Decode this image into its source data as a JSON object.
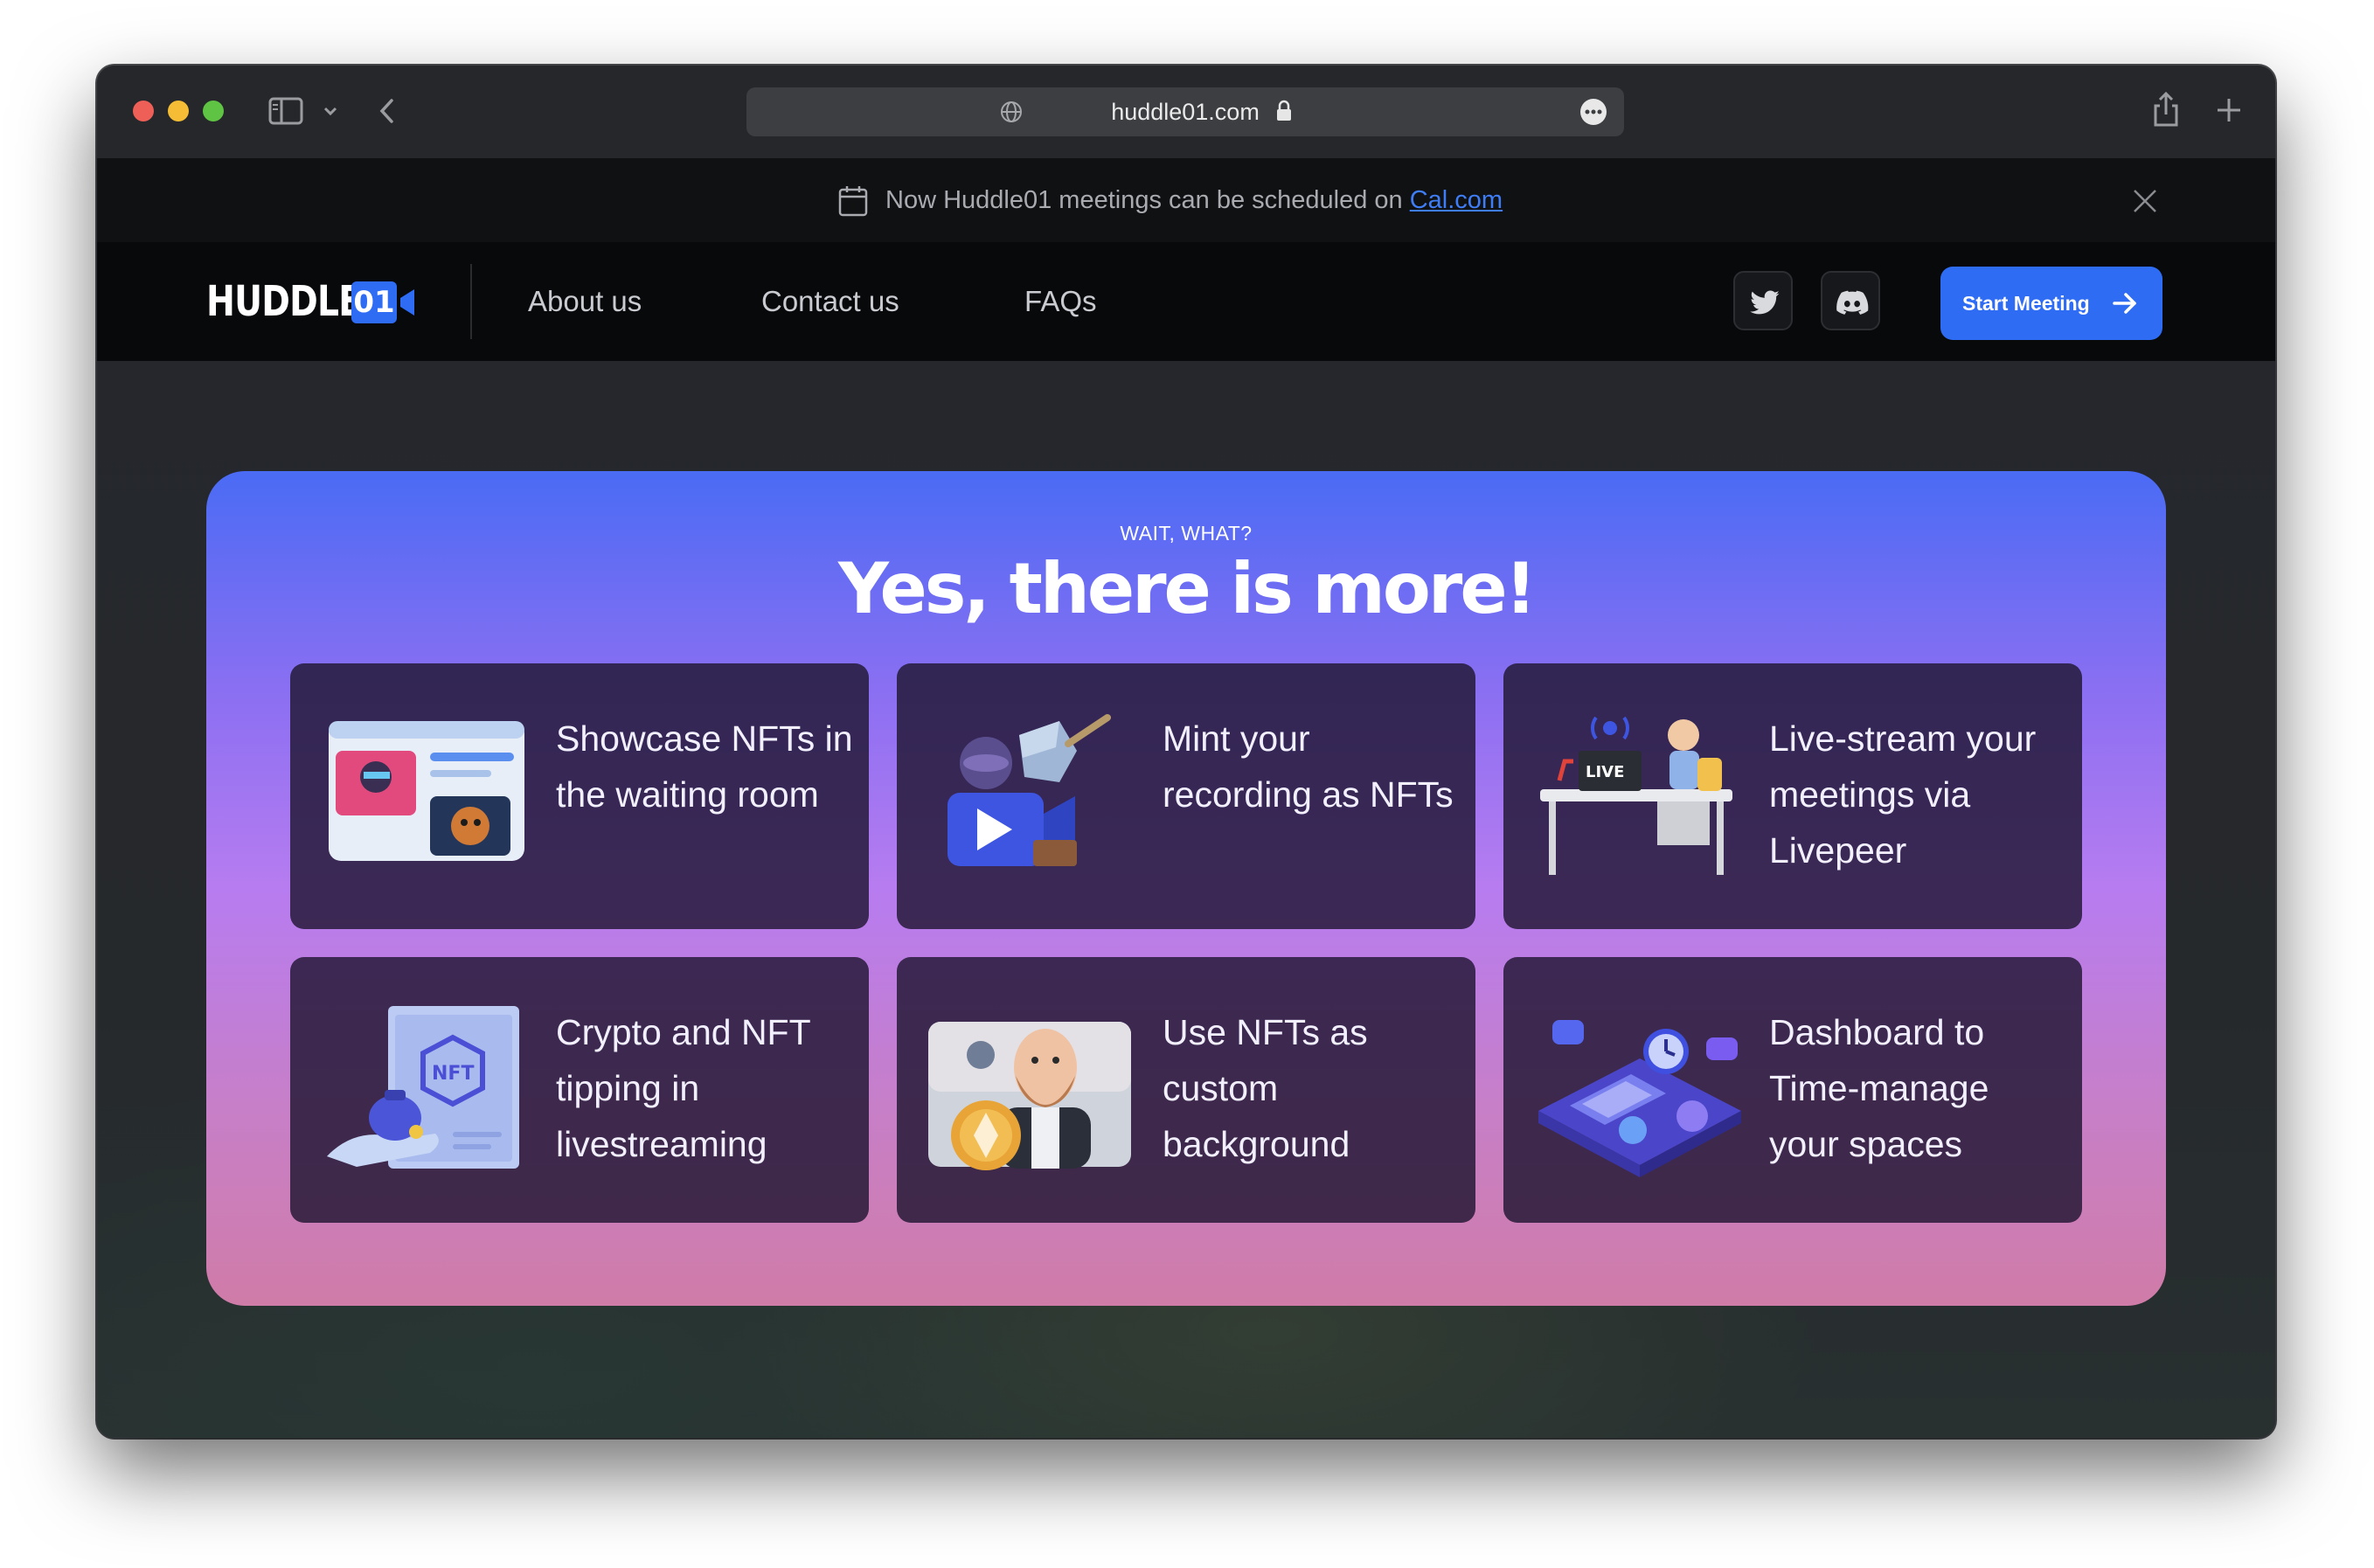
{
  "browser": {
    "url": "huddle01.com"
  },
  "announcement": {
    "text": "Now Huddle01 meetings can be scheduled on ",
    "link_label": "Cal.com"
  },
  "nav": {
    "logo_text": "HUDDLE",
    "logo_number": "01",
    "links": [
      "About us",
      "Contact us",
      "FAQs"
    ],
    "start_button_label": "Start Meeting"
  },
  "hero": {
    "eyebrow": "WAIT, WHAT?",
    "headline": "Yes, there is more!"
  },
  "features": [
    {
      "text": "Showcase NFTs in the waiting room",
      "icon": "nft-waiting-room-illustration"
    },
    {
      "text": "Mint your recording as NFTs",
      "icon": "mint-recording-illustration"
    },
    {
      "text": "Live-stream your meetings via Livepeer",
      "icon": "livestream-desk-illustration",
      "badge": "LIVE"
    },
    {
      "text": "Crypto and NFT tipping in livestreaming",
      "icon": "nft-tipping-illustration",
      "badge": "NFT"
    },
    {
      "text": "Use NFTs as custom background",
      "icon": "nft-background-illustration"
    },
    {
      "text": "Dashboard to Time-manage your spaces",
      "icon": "dashboard-illustration"
    }
  ],
  "colors": {
    "accent": "#2f6cf4",
    "panel_top": "#4a6bf4",
    "panel_bottom": "#d07ca8"
  }
}
